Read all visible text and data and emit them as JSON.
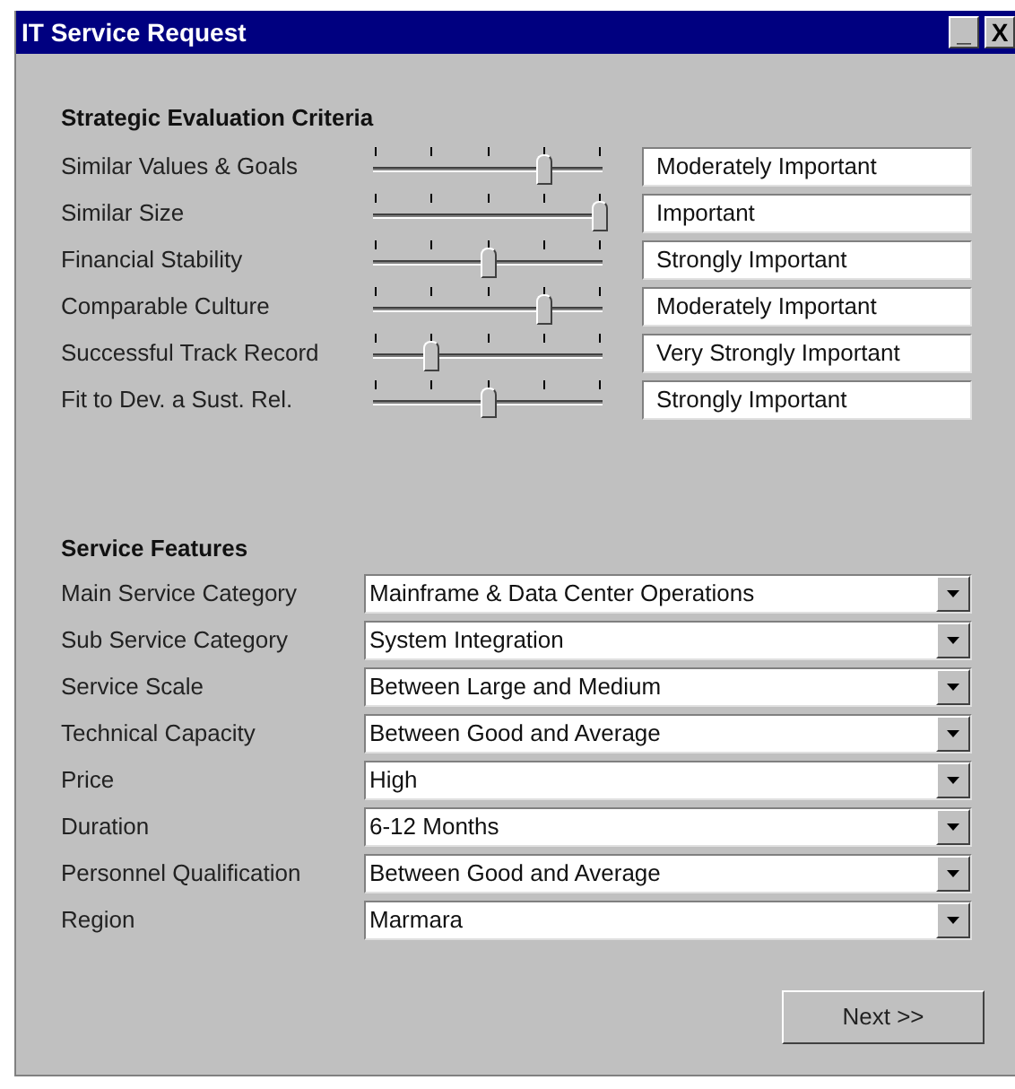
{
  "window": {
    "title": "IT Service Request",
    "buttons": [
      "_",
      "X"
    ]
  },
  "criteria": {
    "title": "Strategic Evaluation Criteria",
    "rows": [
      {
        "label": "Similar Values & Goals",
        "level": 0.75,
        "value": "Moderately Important"
      },
      {
        "label": "Similar Size",
        "level": 1,
        "value": "Important"
      },
      {
        "label": "Financial Stability",
        "level": 0.5,
        "value": "Strongly Important"
      },
      {
        "label": "Comparable Culture",
        "level": 0.75,
        "value": "Moderately Important"
      },
      {
        "label": "Successful Track Record",
        "level": 0.25,
        "value": "Very Strongly Important"
      },
      {
        "label": "Fit to Dev. a Sust. Rel.",
        "level": 0.5,
        "value": "Strongly Important"
      }
    ]
  },
  "features": {
    "title": "Service Features",
    "rows": [
      {
        "label": "Main Service Category",
        "value": "Mainframe & Data Center Operations"
      },
      {
        "label": "Sub Service Category",
        "value": "System Integration"
      },
      {
        "label": "Service Scale",
        "value": "Between Large and Medium"
      },
      {
        "label": "Technical Capacity",
        "value": "Between Good and Average"
      },
      {
        "label": "Price",
        "value": "High"
      },
      {
        "label": "Duration",
        "value": "6-12 Months"
      },
      {
        "label": "Personnel Qualification",
        "value": "Between Good and Average"
      },
      {
        "label": "Region",
        "value": "Marmara"
      }
    ]
  },
  "next_button": "Next >>"
}
